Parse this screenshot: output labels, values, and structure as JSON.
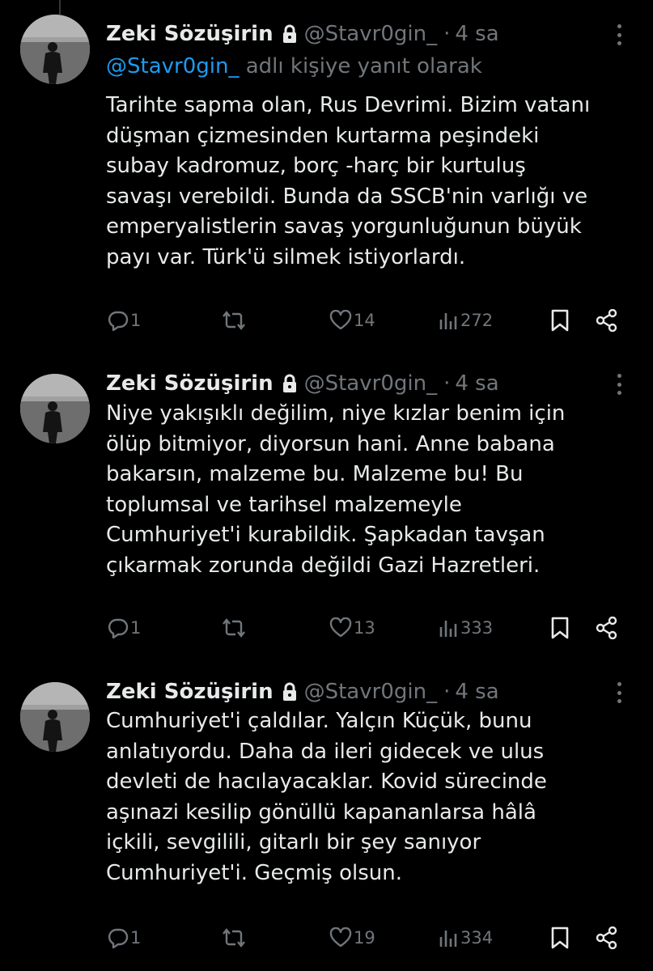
{
  "tweets": [
    {
      "name": "Zeki Sözüşirin",
      "handle": "@Stavr0gin_",
      "separator": "·",
      "time": "4 sa",
      "reply_mention": "@Stavr0gin_",
      "reply_suffix": "adlı kişiye yanıt olarak",
      "lines": [
        "Tarihte sapma olan, Rus Devrimi. Bizim vatanı",
        "düşman çizmesinden kurtarma peşindeki",
        "subay kadromuz, borç -harç bir kurtuluş",
        "savaşı verebildi. Bunda da SSCB'nin varlığı ve",
        "emperyalistlerin savaş yorgunluğunun büyük",
        "payı var. Türk'ü silmek istiyorlardı."
      ],
      "replies": "1",
      "retweets": "",
      "likes": "14",
      "views": "272"
    },
    {
      "name": "Zeki Sözüşirin",
      "handle": "@Stavr0gin_",
      "separator": "·",
      "time": "4 sa",
      "lines": [
        "Niye yakışıklı değilim, niye kızlar benim için",
        "ölüp bitmiyor, diyorsun hani. Anne babana",
        "bakarsın, malzeme bu. Malzeme bu! Bu",
        "toplumsal ve tarihsel malzemeyle",
        "Cumhuriyet'i kurabildik. Şapkadan tavşan",
        "çıkarmak zorunda değildi Gazi Hazretleri."
      ],
      "replies": "1",
      "retweets": "",
      "likes": "13",
      "views": "333"
    },
    {
      "name": "Zeki Sözüşirin",
      "handle": "@Stavr0gin_",
      "separator": "·",
      "time": "4 sa",
      "lines": [
        "Cumhuriyet'i çaldılar. Yalçın Küçük, bunu",
        "anlatıyordu. Daha da ileri gidecek ve ulus",
        "devleti de hacılayacaklar. Kovid sürecinde",
        "aşınazi kesilip gönüllü kapananlarsa hâlâ",
        "içkili, sevgilili, gitarlı bir şey sanıyor",
        "Cumhuriyet'i. Geçmiş olsun."
      ],
      "replies": "1",
      "retweets": "",
      "likes": "19",
      "views": "334"
    }
  ],
  "icons": {
    "reply": "reply-icon",
    "retweet": "retweet-icon",
    "like": "heart-icon",
    "views": "views-icon",
    "bookmark": "bookmark-icon",
    "share": "share-icon",
    "lock": "lock-icon",
    "more": "more-icon"
  },
  "colors": {
    "background": "#000000",
    "text": "#e7e9ea",
    "muted": "#71767b",
    "accent": "#1d9bf0"
  }
}
